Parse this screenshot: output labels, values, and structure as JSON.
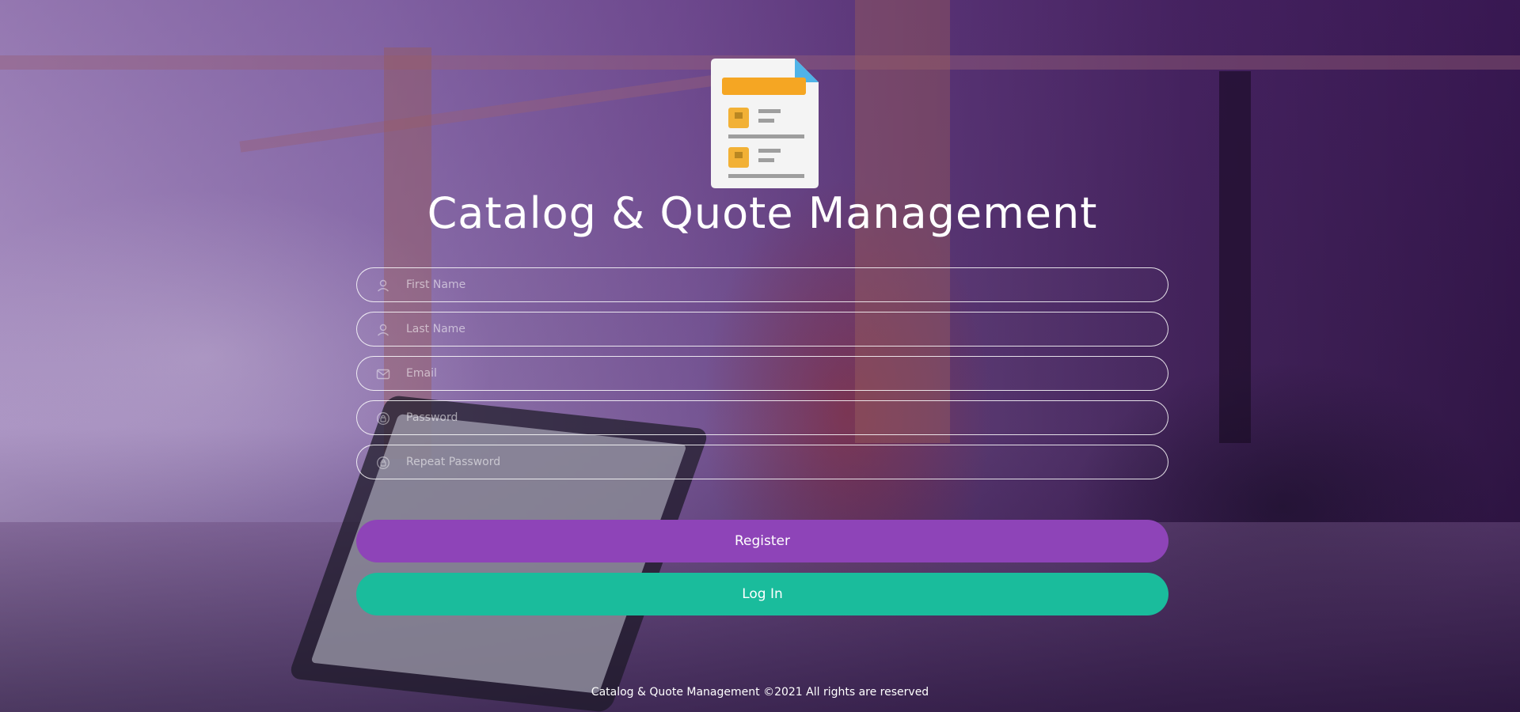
{
  "app": {
    "title": "Catalog & Quote Management"
  },
  "form": {
    "first_name": {
      "placeholder": "First Name",
      "value": ""
    },
    "last_name": {
      "placeholder": "Last Name",
      "value": ""
    },
    "email": {
      "placeholder": "Email",
      "value": ""
    },
    "password": {
      "placeholder": "Password",
      "value": "",
      "icon": "lock-icon"
    },
    "repeat_password": {
      "placeholder": "Repeat Password",
      "value": "",
      "icon": "lock-icon"
    }
  },
  "buttons": {
    "register_label": "Register",
    "login_label": "Log In"
  },
  "footer": {
    "text": "Catalog & Quote Management ©2021 All rights are reserved"
  },
  "colors": {
    "register": "#8e44b8",
    "login": "#1abc9c",
    "logo_header": "#f5a623",
    "logo_corner": "#4fb3e8"
  }
}
